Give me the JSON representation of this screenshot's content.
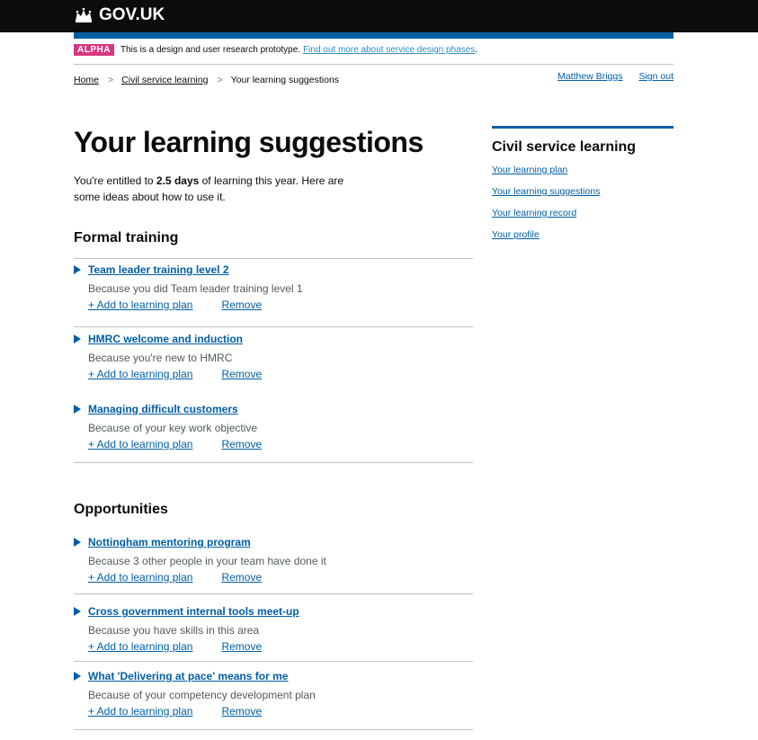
{
  "header": {
    "logo_text": "GOV.UK",
    "logo_icon": "crown-icon"
  },
  "phase_banner": {
    "tag": "ALPHA",
    "text": "This is a design and user research prototype.",
    "link": "Find out more about service design phases",
    "link_suffix": "."
  },
  "breadcrumbs": {
    "home": "Home",
    "section": "Civil service learning",
    "current": "Your learning suggestions",
    "separator": ">"
  },
  "account": {
    "user": "Matthew Briggs",
    "sign_out": "Sign out"
  },
  "main": {
    "title": "Your learning suggestions",
    "intro_before": "You're entitled to ",
    "intro_bold": "2.5 days",
    "intro_after": " of learning this year. Here are some ideas about how to use it."
  },
  "formal_training": {
    "heading": "Formal training",
    "items": [
      {
        "title": "Team leader training level 2",
        "reason": "Because you did Team leader training level 1",
        "add": "+ Add to learning plan",
        "remove": "Remove"
      },
      {
        "title": "HMRC welcome and induction",
        "reason": "Because you're new to HMRC",
        "add": "+ Add to learning plan",
        "remove": "Remove"
      },
      {
        "title": "Managing difficult customers",
        "reason": "Because of your key work objective",
        "add": "+ Add to learning plan",
        "remove": "Remove"
      }
    ]
  },
  "opportunities": {
    "heading": "Opportunities",
    "items": [
      {
        "title": "Nottingham mentoring program",
        "reason": "Because 3 other people in your team have done it",
        "add": "+ Add to learning plan",
        "remove": "Remove"
      },
      {
        "title": "Cross government internal tools meet-up",
        "reason": "Because you have skills in this area",
        "add": "+ Add to learning plan",
        "remove": "Remove"
      },
      {
        "title": "What 'Delivering at pace' means for me",
        "reason": "Because of your competency development plan",
        "add": "+ Add to learning plan",
        "remove": "Remove"
      }
    ]
  },
  "sidebar": {
    "title": "Civil service learning",
    "links": [
      "Your learning plan",
      "Your learning suggestions",
      "Your learning record",
      "Your profile"
    ]
  },
  "colors": {
    "header_bg": "#0b0c0c",
    "brand_blue": "#005ea5",
    "alpha_tag": "#d53880",
    "link": "#005ea5"
  }
}
